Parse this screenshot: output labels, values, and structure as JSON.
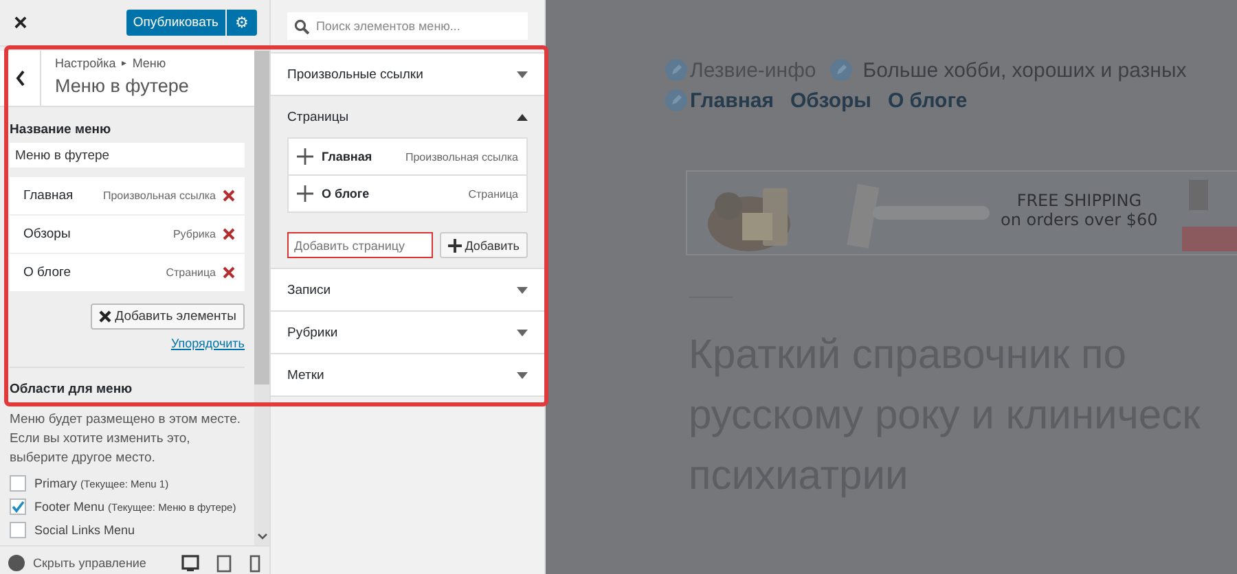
{
  "topbar": {
    "close": "×",
    "publish_button": "Опубликовать",
    "settings": "⚙"
  },
  "menu_panel": {
    "breadcrumb": [
      "Настройка",
      "Меню"
    ],
    "breadcrumb_separator": "▸",
    "title": "Меню в футере",
    "name_label": "Название меню",
    "name_value": "Меню в футере",
    "items": [
      {
        "title": "Главная",
        "type": "Произвольная ссылка"
      },
      {
        "title": "Обзоры",
        "type": "Рубрика"
      },
      {
        "title": "О блоге",
        "type": "Страница"
      }
    ],
    "add_button": "Добавить элементы",
    "reorder_link": "Упорядочить",
    "locations_heading": "Области для меню",
    "locations_description": "Меню будет размещено в этом месте. Если вы хотите изменить это, выберите другое место.",
    "locations": [
      {
        "name": "Primary",
        "current": "(Текущее: Menu 1)",
        "checked": false
      },
      {
        "name": "Footer Menu",
        "current": "(Текущее: Меню в футере)",
        "checked": true
      },
      {
        "name": "Social Links Menu",
        "checked": false
      }
    ],
    "hide_controls": "Скрыть управление"
  },
  "items_panel": {
    "search_placeholder": "Поиск элементов меню...",
    "sections": [
      {
        "title": "Произвольные ссылки",
        "expanded": false
      },
      {
        "title": "Страницы",
        "expanded": true,
        "items": [
          {
            "title": "Главная",
            "type": "Произвольная ссылка"
          },
          {
            "title": "О блоге",
            "type": "Страница"
          }
        ],
        "new_placeholder": "Добавить страницу",
        "add_button": "Добавить"
      },
      {
        "title": "Записи",
        "expanded": false
      },
      {
        "title": "Рубрики",
        "expanded": false
      },
      {
        "title": "Метки",
        "expanded": false
      }
    ]
  },
  "preview": {
    "site_title": "Лезвие-инфо",
    "tagline": "Больше хобби, хороших и разных",
    "nav": [
      "Главная",
      "Обзоры",
      "О блоге"
    ],
    "banner": {
      "kind": "picture",
      "headline": "FREE SHIPPING",
      "subline": "on orders over $60"
    },
    "post_title_lines": [
      "Краткий справочник по",
      "русскому року и клиническ",
      "психиатрии"
    ]
  }
}
